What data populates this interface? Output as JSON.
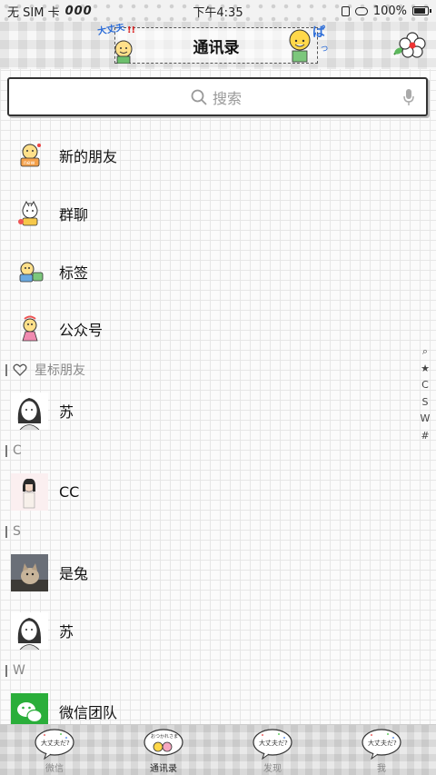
{
  "status_bar": {
    "carrier": "无 SIM 卡",
    "signal": "000",
    "time": "下午4:35",
    "battery": "100%"
  },
  "header": {
    "title": "通讯录"
  },
  "search": {
    "placeholder": "搜索"
  },
  "functions": [
    {
      "label": "新的朋友",
      "icon": "new-friends-icon"
    },
    {
      "label": "群聊",
      "icon": "group-chat-icon"
    },
    {
      "label": "标签",
      "icon": "tags-icon"
    },
    {
      "label": "公众号",
      "icon": "official-accounts-icon"
    }
  ],
  "sections": {
    "starred": "星标朋友",
    "c": "C",
    "s": "S",
    "w": "W"
  },
  "contacts": {
    "starred": [
      "苏"
    ],
    "c": [
      "CC"
    ],
    "s": [
      "是兔",
      "苏"
    ],
    "w": [
      "微信团队"
    ]
  },
  "index_bar": [
    "⌕",
    "★",
    "C",
    "S",
    "W",
    "#"
  ],
  "tabs": [
    {
      "label": "微信",
      "active": false
    },
    {
      "label": "通讯录",
      "active": true
    },
    {
      "label": "发现",
      "active": false
    },
    {
      "label": "我",
      "active": false
    }
  ],
  "colors": {
    "wechat_green": "#2aae3a",
    "text": "#111111",
    "muted": "#888888"
  }
}
